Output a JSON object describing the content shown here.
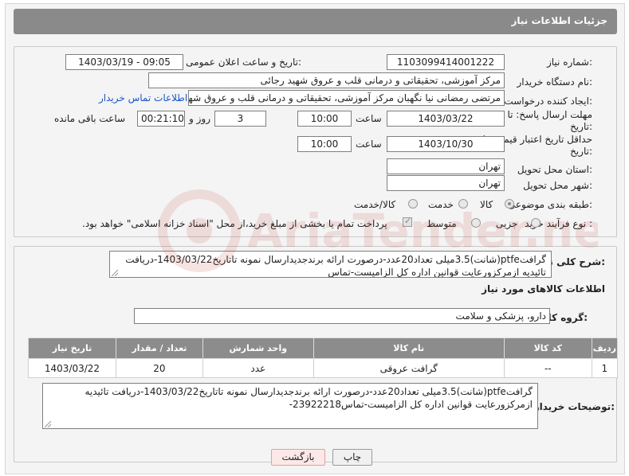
{
  "header": {
    "title": "جزئیات اطلاعات نیاز"
  },
  "fields": {
    "need_number_label": "شماره نیاز:",
    "need_number": "1103099414001222",
    "announce_label": "تاریخ و ساعت اعلان عمومی:",
    "announce_value": "1403/03/19 - 09:05",
    "buyer_org_label": "نام دستگاه خریدار:",
    "buyer_org": "مرکز آموزشی، تحقیقاتی و درمانی قلب و عروق شهید رجائی",
    "creator_label": "ایجاد کننده درخواست:",
    "creator": "مرتضی رمضانی نیا نگهبان مرکز آموزشی، تحقیقاتی و درمانی قلب و عروق شهید رجائی",
    "contact_link": "اطلاعات تماس خریدار",
    "reply_deadline_label": "مهلت ارسال پاسخ: تا",
    "reply_deadline_label2": "تاریخ:",
    "reply_date": "1403/03/22",
    "time_label": "ساعت",
    "reply_time": "10:00",
    "days_value": "3",
    "days_label": "روز و",
    "remaining_time": "00:21:10",
    "remaining_label": "ساعت باقی مانده",
    "validity_label": "حداقل تاریخ اعتبار قیمت: تا",
    "validity_label2": "تاریخ:",
    "validity_date": "1403/10/30",
    "validity_time": "10:00",
    "province_label": "استان محل تحویل:",
    "province": "تهران",
    "city_label": "شهر محل تحویل:",
    "city": "تهران",
    "category_label": "طبقه بندی موضوعی:",
    "category_options": [
      "کالا",
      "خدمت",
      "کالا/خدمت"
    ],
    "category_selected": "کالا",
    "process_label": "نوع فرآیند خرید :",
    "process_options": [
      "جزیی",
      "متوسط"
    ],
    "payment_note": "پرداخت تمام یا بخشی از مبلغ خرید،از محل \"اسناد خزانه اسلامی\" خواهد بود."
  },
  "description": {
    "label": "شرح کلی نیاز:",
    "text": "گرافتptfe(شانت)3.5میلی تعداد20عدد-درصورت ارائه برندجدیدارسال نمونه تاتاریخ1403/03/22-دریافت تائیدیه ازمرکزورعایت قوانین اداره کل الزامیست-تماس"
  },
  "goods": {
    "section_title": "اطلاعات کالاهای مورد نیاز",
    "group_label": "گروه کالا:",
    "group_value": "دارو، پزشکی و سلامت",
    "columns": [
      "ردیف",
      "کد کالا",
      "نام کالا",
      "واحد شمارش",
      "تعداد / مقدار",
      "تاریخ نیاز"
    ],
    "rows": [
      {
        "index": "1",
        "code": "--",
        "name": "گرافت عروقی",
        "unit": "عدد",
        "qty": "20",
        "date": "1403/03/22"
      }
    ]
  },
  "buyer_notes": {
    "label": "توضیحات خریدار:",
    "text": "گرافتptfe(شانت)3.5میلی تعداد20عدد-درصورت ارائه برندجدیدارسال نمونه تاتاریخ1403/03/22-دریافت تائیدیه ازمرکزورعایت قوانین اداره کل الزامیست-تماس23922218-"
  },
  "buttons": {
    "print": "چاپ",
    "back": "بازگشت"
  },
  "watermark": {
    "text": "AriaTender.neT"
  }
}
